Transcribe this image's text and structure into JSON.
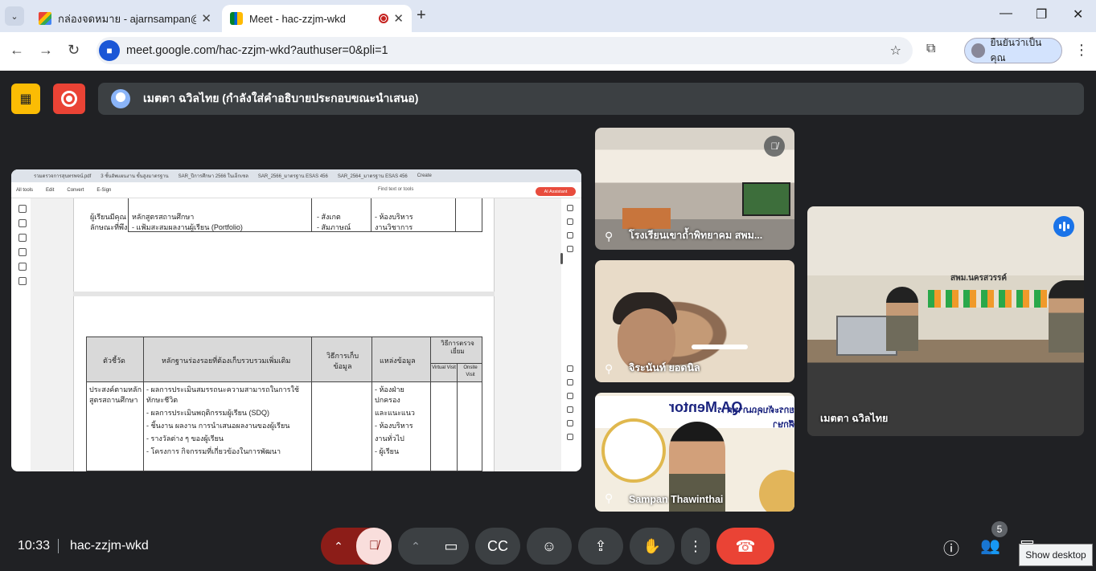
{
  "browser": {
    "tabs": [
      {
        "title": "กล่องจดหมาย - ajarnsampan@gmail.com",
        "icon": "gmail-icon",
        "active": false
      },
      {
        "title": "Meet - hac-zzjm-wkd",
        "icon": "meet-icon",
        "active": true
      }
    ],
    "url": "meet.google.com/hac-zzjm-wkd?authuser=0&pli=1",
    "profile_label": "ยืนยันว่าเป็นคุณ"
  },
  "meet": {
    "presenter_text": "เมตตา ฉวิลไทย (กำลังใส่คำอธิบายประกอบขณะนำเสนอ)",
    "shared_screen": {
      "tabs": [
        "รวมตรวจการสุนทรพจน์.pdf",
        "3 ชั้นอัพแผนงาน ขั้นสูงมาตรฐาน",
        "SAR_ปีการศึกษา 2566 ในเอ็กเซล",
        "SAR_2566_มาตรฐาน ESAS 456",
        "SAR_2564_มาตรฐาน ESAS 456",
        "Create"
      ],
      "menu": [
        "All tools",
        "Edit",
        "Convert",
        "E-Sign"
      ],
      "find_text": "Find text or tools",
      "ai_button": "AI Assistant",
      "upper_rows": [
        [
          "ผู้เรียนมีคุณ",
          "หลักสูตรสถานศึกษา",
          "- สังเกต",
          "- ห้องบริหาร"
        ],
        [
          "ลักษณะที่พึง",
          "- แฟ้มสะสมผลงานผู้เรียน (Portfolio)",
          "- สัมภาษณ์",
          "งานวิชาการ"
        ]
      ],
      "table_header": [
        "ตัวชี้วัด",
        "หลักฐานร่องรอยที่ต้องเก็บรวบรวมเพิ่มเติม",
        "วิธีการเก็บข้อมูล",
        "แหล่งข้อมูล",
        "วิธีการตรวจเยี่ยม",
        "Virtual Visit",
        "Onsite Visit"
      ],
      "table_body": {
        "indicator": [
          "ประสงค์ตามหลัก",
          "สูตรสถานศึกษา"
        ],
        "evidence": [
          "- ผลการประเมินสมรรถนะความสามารถในการใช้",
          "ทักษะชีวิต",
          "- ผลการประเมินพฤติกรรมผู้เรียน (SDQ)",
          "- ชิ้นงาน ผลงาน การนำเสนอผลงานของผู้เรียน",
          "- รางวัลต่าง ๆ ของผู้เรียน",
          "- โครงการ กิจกรรมที่เกี่ยวข้องในการพัฒนา"
        ],
        "source": [
          "- ห้องฝ่าย",
          "ปกครอง",
          "และแนะแนว",
          "- ห้องบริหาร",
          "งานทั่วไป",
          "- ผู้เรียน"
        ]
      }
    },
    "participants": [
      {
        "name": "โรงเรียนเขาถ้ำพิทยาคม สพม...",
        "muted": true
      },
      {
        "name": "จิระนันท์ ยอดนิล"
      },
      {
        "name": "Sampan Thawinthai",
        "slide_text": "QA Mentor",
        "slide_subtitle": "ยกระดับคุณภาพการศึกษา"
      },
      {
        "name": "เมตตา ฉวิลไทย",
        "speaking": true,
        "sign": "สพม.นครสวรรค์"
      }
    ],
    "time": "10:33",
    "meeting_code": "hac-zzjm-wkd",
    "participant_count": "5",
    "tooltip": "Show desktop"
  }
}
